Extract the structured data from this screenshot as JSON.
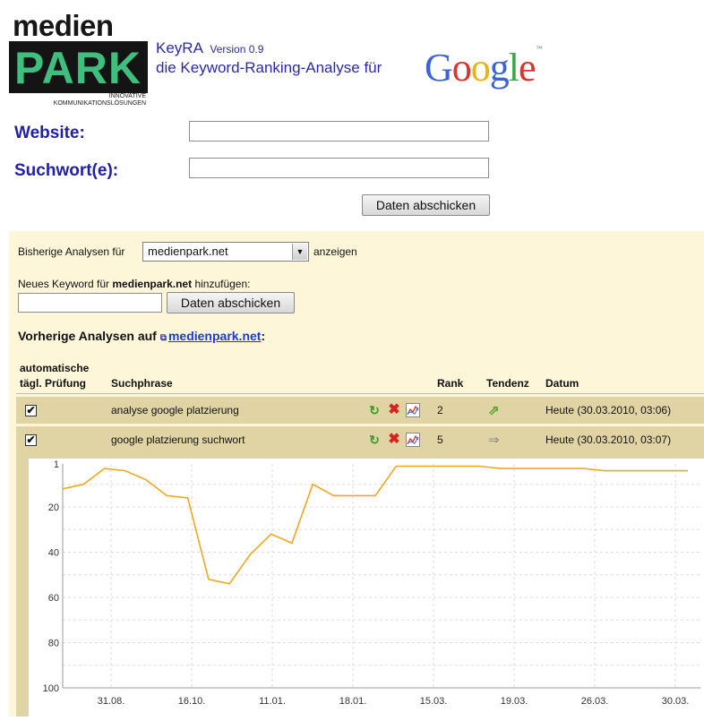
{
  "header": {
    "logo_word1": "medien",
    "logo_word2": "PARK",
    "logo_sub1": "INNOVATIVE",
    "logo_sub2": "KOMMUNIKATIONSLÖSUNGEN",
    "app_name": "KeyRA",
    "version": "Version 0.9",
    "tagline": "die Keyword-Ranking-Analyse für",
    "brand_logo": "Google",
    "brand_colors": [
      "#3b64d6",
      "#d8362a",
      "#e9b21a",
      "#3b64d6",
      "#3aa64a",
      "#d8362a"
    ]
  },
  "form": {
    "website_label": "Website:",
    "website_value": "",
    "keyword_label": "Suchwort(e):",
    "keyword_value": "",
    "submit_label": "Daten abschicken"
  },
  "analyses": {
    "prev_prefix": "Bisherige Analysen für",
    "selected_site": "medienpark.net",
    "prev_suffix": "anzeigen",
    "new_kw_prefix": "Neues Keyword für",
    "new_kw_site": "medienpark.net",
    "new_kw_suffix": "hinzufügen:",
    "new_kw_value": "",
    "new_kw_button": "Daten abschicken",
    "previous_heading": "Vorherige Analysen auf",
    "previous_link": "medienpark.net",
    "previous_colon": ":"
  },
  "table": {
    "headers": {
      "auto_line1": "automatische",
      "auto_line2": "tägl. Prüfung",
      "phrase": "Suchphrase",
      "rank": "Rank",
      "trend": "Tendenz",
      "date": "Datum"
    },
    "rows": [
      {
        "checked": "✔",
        "phrase": "analyse google platzierung",
        "rank": "2",
        "trend": "⇗",
        "trend_icon": "arrow-up-icon",
        "date": "Heute (30.03.2010, 03:06)"
      },
      {
        "checked": "✔",
        "phrase": "google platzierung suchwort",
        "rank": "5",
        "trend": "⇒",
        "trend_icon": "arrow-right-icon",
        "date": "Heute (30.03.2010, 03:07)"
      }
    ]
  },
  "colors": {
    "label_blue": "#1f1fa8",
    "panel_bg": "#fdf6d9",
    "row_bg": "#e0d4a4",
    "line": "#f0a820"
  },
  "chart_data": {
    "type": "line",
    "title": "",
    "xlabel": "",
    "ylabel": "",
    "y_inverted": true,
    "ylim": [
      1,
      100
    ],
    "y_ticks": [
      "1",
      "20",
      "40",
      "60",
      "80",
      "100"
    ],
    "y_tick_values": [
      1,
      20,
      40,
      60,
      80,
      100
    ],
    "x_ticks": [
      "31.08.",
      "16.10.",
      "11.01.",
      "18.01.",
      "15.03.",
      "19.03.",
      "26.03.",
      "30.03."
    ],
    "grid": true,
    "series": [
      {
        "values": [
          12,
          10,
          3,
          4,
          8,
          15,
          16,
          52,
          54,
          41,
          32,
          36,
          10,
          15,
          15,
          15,
          2,
          2,
          2,
          2,
          2,
          3,
          3,
          3,
          3,
          3,
          4,
          4,
          4,
          4,
          4
        ]
      }
    ]
  }
}
